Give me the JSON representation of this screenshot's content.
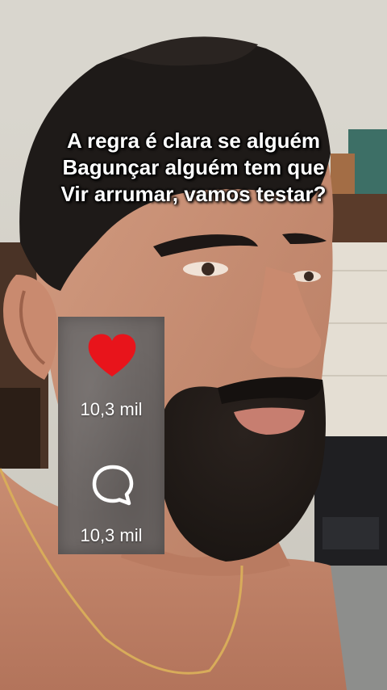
{
  "caption": {
    "lines": [
      "A regra é clara se alguém",
      "Bagunçar alguém tem que",
      "Vir arrumar, vamos testar?"
    ],
    "color": "#ffffff"
  },
  "engagement": {
    "likes": {
      "icon": "heart-icon",
      "count": "10,3 mil",
      "color": "#e8141b"
    },
    "comments": {
      "icon": "comment-bubble-icon",
      "count": "10,3 mil"
    }
  }
}
